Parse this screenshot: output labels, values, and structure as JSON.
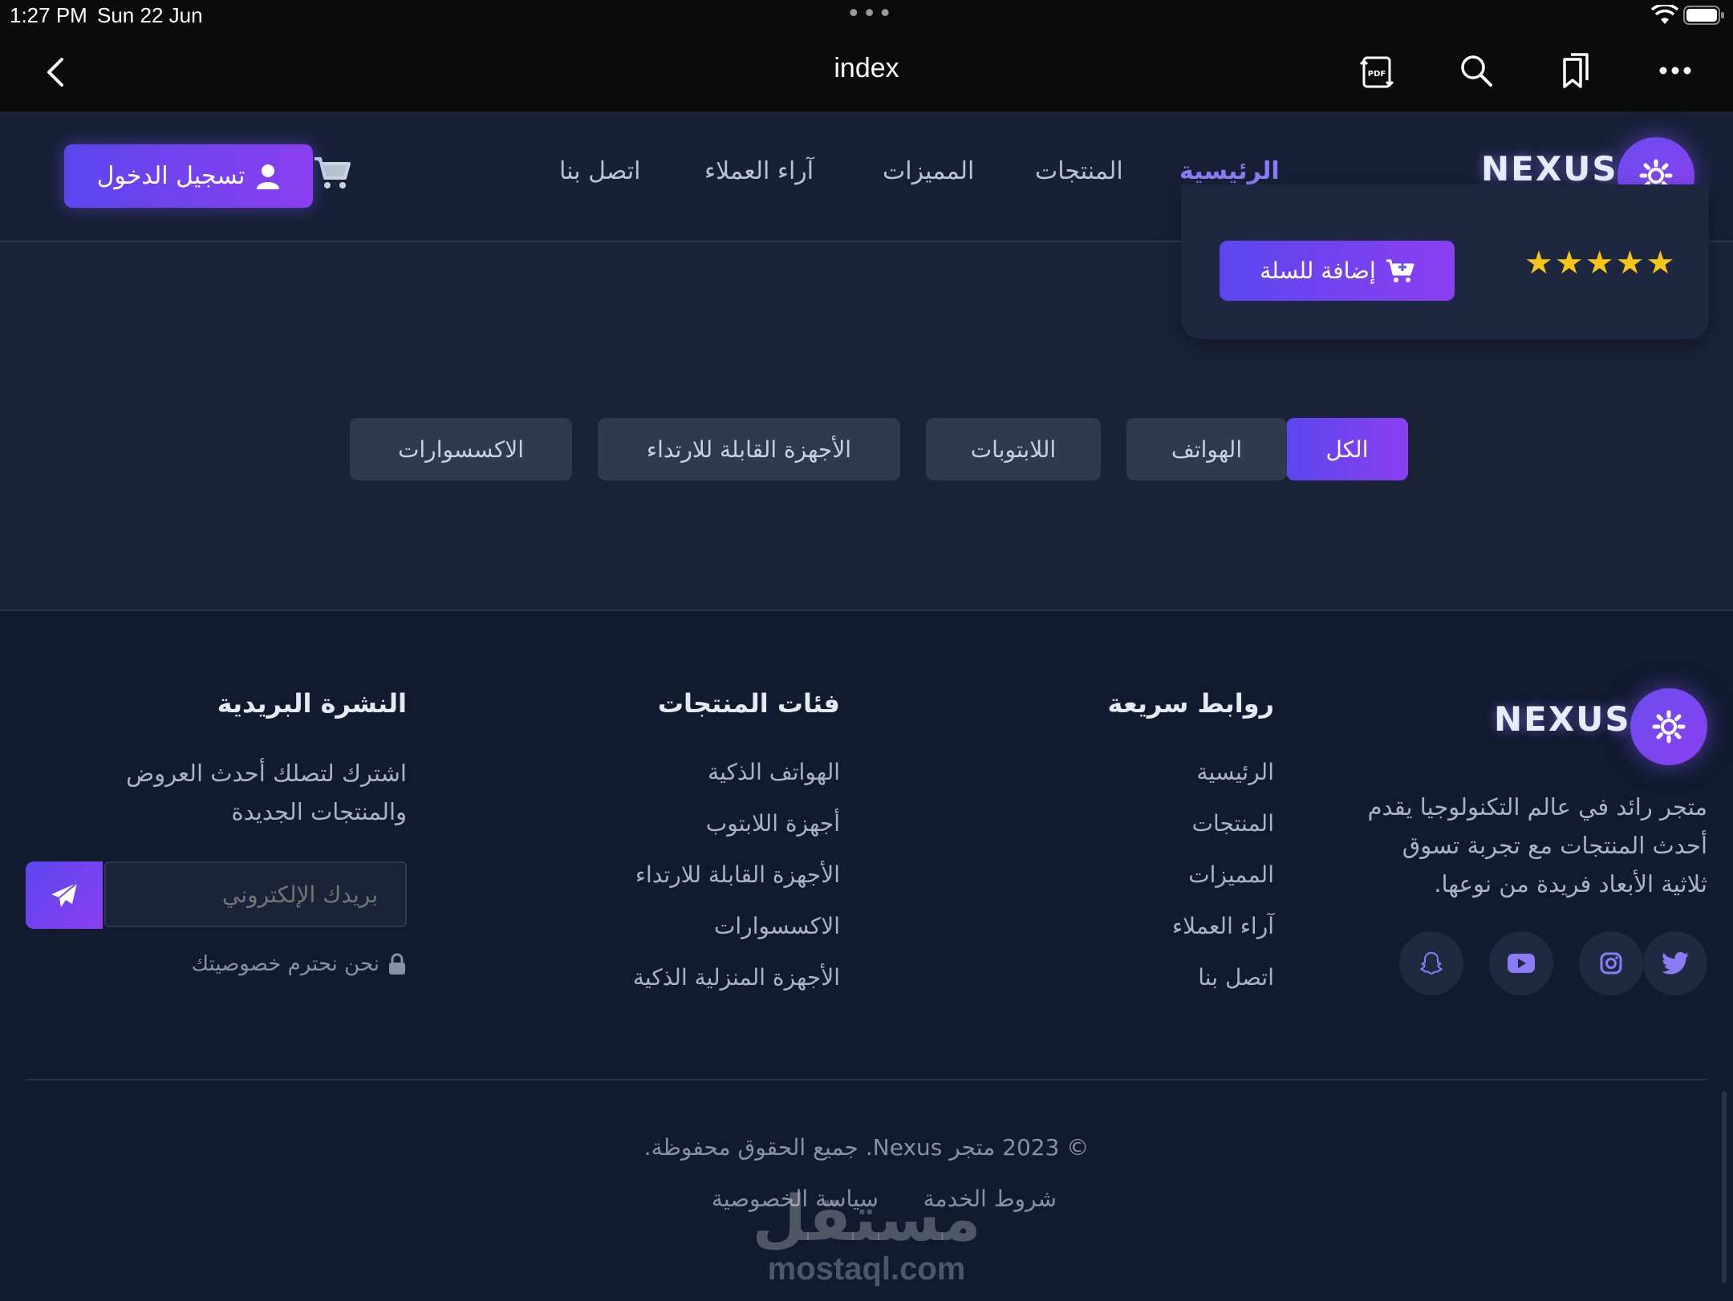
{
  "status_bar": {
    "time": "1:27 PM",
    "date": "Sun 22 Jun"
  },
  "browser": {
    "title": "index"
  },
  "nav": {
    "brand": "NEXUS",
    "links": [
      "الرئيسية",
      "المنتجات",
      "المميزات",
      "آراء العملاء",
      "اتصل بنا"
    ],
    "login_label": "تسجيل الدخول"
  },
  "product_card": {
    "add_to_cart": "إضافة للسلة",
    "rating_stars": 5
  },
  "filters": {
    "tabs": [
      "الكل",
      "الهواتف",
      "اللابتوبات",
      "الأجهزة القابلة للارتداء",
      "الاكسسوارات"
    ],
    "active": "الكل"
  },
  "footer": {
    "brand": "NEXUS",
    "description_lines": [
      "متجر رائد في عالم التكنولوجيا يقدم",
      "أحدث المنتجات مع تجربة تسوق",
      "ثلاثية الأبعاد فريدة من نوعها."
    ],
    "quick_links": {
      "title": "روابط سريعة",
      "items": [
        "الرئيسية",
        "المنتجات",
        "المميزات",
        "آراء العملاء",
        "اتصل بنا"
      ]
    },
    "categories": {
      "title": "فئات المنتجات",
      "items": [
        "الهواتف الذكية",
        "أجهزة اللابتوب",
        "الأجهزة القابلة للارتداء",
        "الاكسسوارات",
        "الأجهزة المنزلية الذكية"
      ]
    },
    "newsletter": {
      "title": "النشرة البريدية",
      "text_lines": [
        "اشترك لتصلك أحدث العروض",
        "والمنتجات الجديدة"
      ],
      "email_placeholder": "بريدك الإلكتروني",
      "privacy_note": "نحن نحترم خصوصيتك"
    },
    "social_icons": [
      "twitter-icon",
      "instagram-icon",
      "youtube-icon",
      "snapchat-icon"
    ],
    "copyright": "© 2023 متجر Nexus. جميع الحقوق محفوظة.",
    "legal": [
      "شروط الخدمة",
      "سياسة الخصوصية"
    ]
  },
  "watermark": {
    "arabic": "مستقل",
    "latin": "mostaql.com"
  },
  "colors": {
    "accent": "#7c4df0",
    "active_link": "#8b7cf6",
    "star": "#f5c518",
    "background": "#1a2236"
  }
}
